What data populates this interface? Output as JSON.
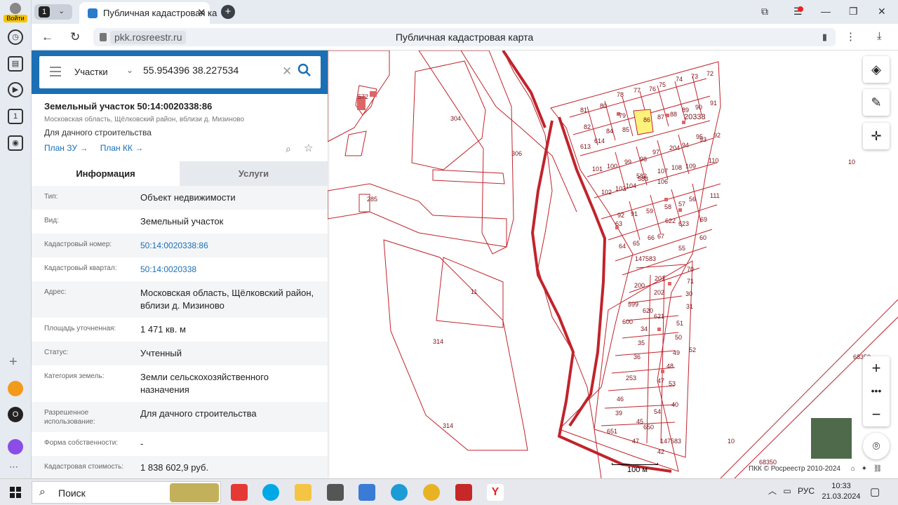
{
  "browser": {
    "login_label": "Войти",
    "tab_count": "1",
    "tab_title": "Публичная кадастровая ка",
    "url_domain": "pkk.rosreestr.ru",
    "page_title": "Публичная кадастровая карта"
  },
  "search": {
    "category": "Участки",
    "query": "55.954396 38.227534"
  },
  "parcel": {
    "title": "Земельный участок 50:14:0020338:86",
    "address_short": "Московская область, Щёлковский район, вблизи д. Мизиново",
    "usage_short": "Для дачного строительства",
    "plan_zu": "План ЗУ →",
    "plan_kk": "План КК →"
  },
  "tabs": {
    "info": "Информация",
    "services": "Услуги"
  },
  "info_rows": [
    {
      "key": "Тип:",
      "value": "Объект недвижимости",
      "link": false
    },
    {
      "key": "Вид:",
      "value": "Земельный участок",
      "link": false
    },
    {
      "key": "Кадастровый номер:",
      "value": "50:14:0020338:86",
      "link": true
    },
    {
      "key": "Кадастровый квартал:",
      "value": "50:14:0020338",
      "link": true
    },
    {
      "key": "Адрес:",
      "value": "Московская область, Щёлковский район, вблизи д. Мизиново",
      "link": false
    },
    {
      "key": "Площадь уточненная:",
      "value": "1 471 кв. м",
      "link": false
    },
    {
      "key": "Статус:",
      "value": "Учтенный",
      "link": false
    },
    {
      "key": "Категория земель:",
      "value": "Земли сельскохозяйственного назначения",
      "link": false
    },
    {
      "key": "Разрешенное использование:",
      "value": "Для дачного строительства",
      "link": false
    },
    {
      "key": "Форма собственности:",
      "value": "-",
      "link": false
    },
    {
      "key": "Кадастровая стоимость:",
      "value": "1 838 602,9 руб.",
      "link": false
    }
  ],
  "map": {
    "labels": [
      "572",
      "304",
      "306",
      "11",
      "314",
      "314",
      "285",
      "20338",
      "10",
      "10",
      "147583",
      "147583",
      "68350",
      "68350",
      "81",
      "80",
      "78",
      "77",
      "76",
      "75",
      "74",
      "73",
      "72",
      "79",
      "82",
      "84",
      "85",
      "86",
      "87",
      "88",
      "89",
      "90",
      "91",
      "613",
      "614",
      "93",
      "92",
      "94",
      "95",
      "204",
      "97",
      "99",
      "98",
      "101",
      "100",
      "107",
      "108",
      "109",
      "110",
      "102",
      "103",
      "104",
      "583",
      "582",
      "106",
      "111",
      "56",
      "57",
      "58",
      "59",
      "91",
      "92",
      "63",
      "623",
      "622",
      "69",
      "64",
      "65",
      "66",
      "67",
      "55",
      "60",
      "70",
      "71",
      "200",
      "201",
      "202",
      "30",
      "31",
      "599",
      "620",
      "621",
      "600",
      "34",
      "35",
      "51",
      "50",
      "49",
      "52",
      "36",
      "48",
      "253",
      "47",
      "53",
      "46",
      "39",
      "40",
      "54",
      "45",
      "650",
      "651",
      "47",
      "42",
      "43"
    ],
    "scale_label": "100 м",
    "copyright": "ПКК © Росреестр 2010-2024"
  },
  "taskbar": {
    "search_label": "Поиск",
    "lang": "РУС",
    "time": "10:33",
    "date": "21.03.2024"
  },
  "colors": {
    "accent": "#1a6fb5",
    "parcel_line": "#c0242c",
    "selected_parcel": "#fff27a"
  }
}
